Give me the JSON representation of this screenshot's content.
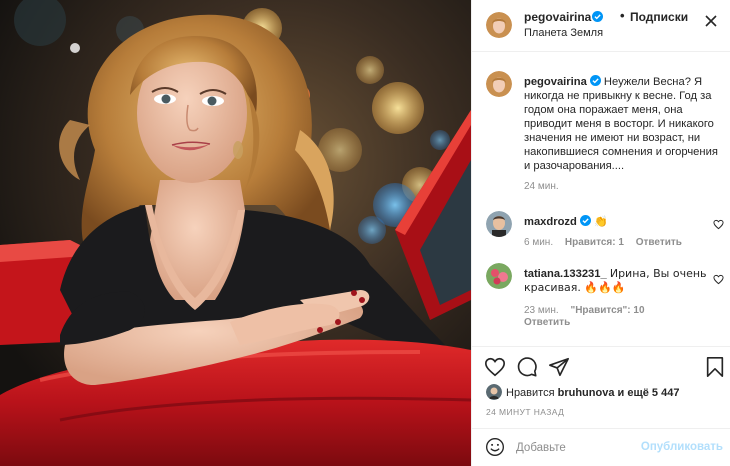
{
  "colors": {
    "text": "#262626",
    "secondary": "#8e8e8e",
    "border": "#efefef",
    "verified": "#0095f6",
    "publish_disabled": "#b2dffc",
    "car_red": "#c8161c"
  },
  "post": {
    "image_alt": "photo",
    "header": {
      "username": "pegovairina",
      "dot": "•",
      "follow_label": "Подписки",
      "location": "Планета Земля",
      "more_icon": "more-horizontal-icon"
    },
    "caption": {
      "username": "pegovairina",
      "text": "Неужели Весна? Я никогда не привыкну к весне. Год за годом она поражает меня, она приводит меня в восторг. И никакого значения не имеют ни возраст, ни накопившиеся сомнения и огорчения и разочарования....",
      "time": "24 мин."
    },
    "comments": [
      {
        "username": "maxdrozd",
        "verified": true,
        "text": "👏",
        "time": "6 мин.",
        "likes": "Нравится: 1",
        "reply": "Ответить"
      },
      {
        "username": "tatiana.133231_",
        "verified": false,
        "text": "Ирина, Вы очень красивая. 🔥🔥🔥",
        "time": "23 мин.",
        "likes": "\"Нравится\": 10",
        "reply": "Ответить"
      }
    ],
    "actions": {
      "like_icon": "heart-icon",
      "comment_icon": "comment-icon",
      "share_icon": "share-icon",
      "save_icon": "bookmark-icon"
    },
    "likes": {
      "prefix": "Нравится",
      "user": "bruhunova",
      "suffix": "и ещё 5 447"
    },
    "posted_ago": "24 МИНУТ НАЗАД",
    "add_comment": {
      "placeholder": "Добавьте",
      "publish_label": "Опубликовать"
    }
  }
}
